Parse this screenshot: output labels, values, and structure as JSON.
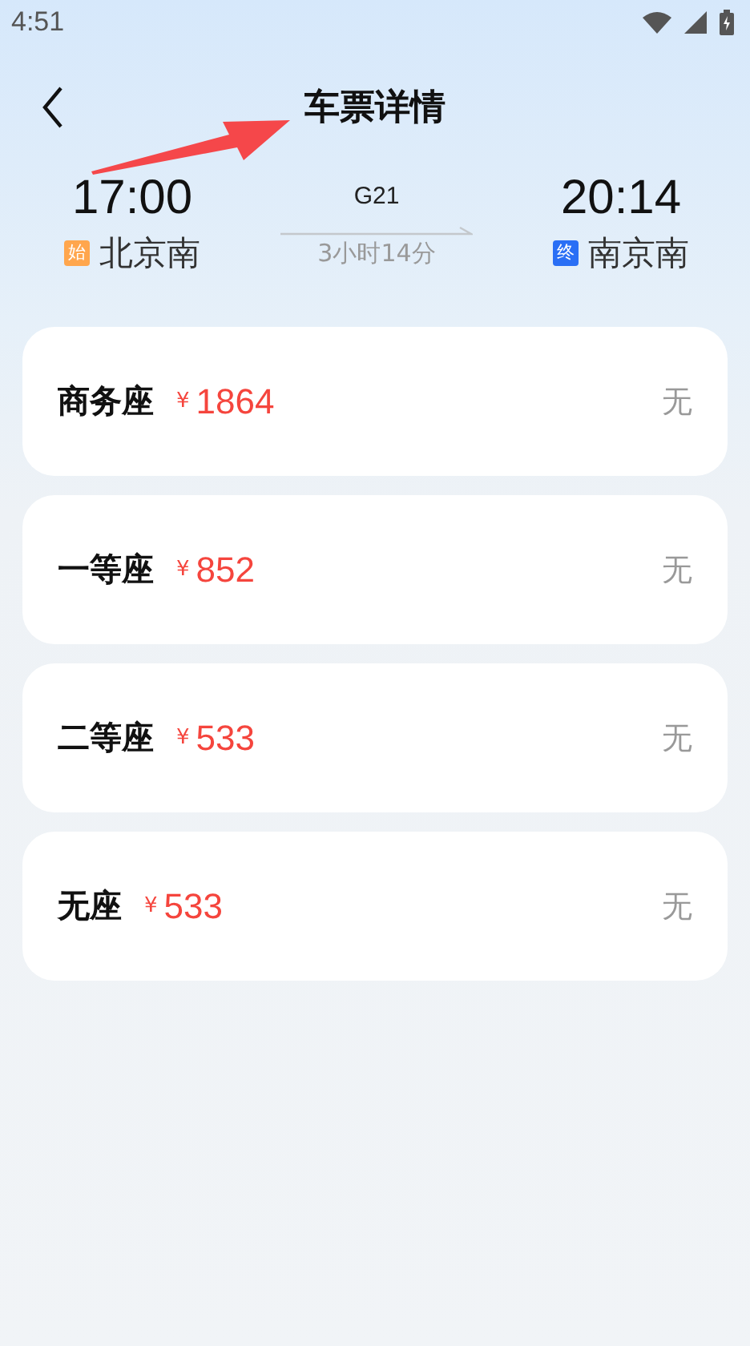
{
  "status_bar": {
    "time": "4:51"
  },
  "header": {
    "title": "车票详情"
  },
  "trip": {
    "departure": {
      "time": "17:00",
      "badge": {
        "label": "始",
        "color": "#ffa64d"
      },
      "station": "北京南"
    },
    "train": {
      "number": "G21",
      "duration": "3小时14分"
    },
    "arrival": {
      "time": "20:14",
      "badge": {
        "label": "终",
        "color": "#2a6ff5"
      },
      "station": "南京南"
    }
  },
  "seats": [
    {
      "name": "商务座",
      "currency": "¥",
      "price": "1864",
      "availability": "无"
    },
    {
      "name": "一等座",
      "currency": "¥",
      "price": "852",
      "availability": "无"
    },
    {
      "name": "二等座",
      "currency": "¥",
      "price": "533",
      "availability": "无"
    },
    {
      "name": "无座",
      "currency": "¥",
      "price": "533",
      "availability": "无"
    }
  ]
}
